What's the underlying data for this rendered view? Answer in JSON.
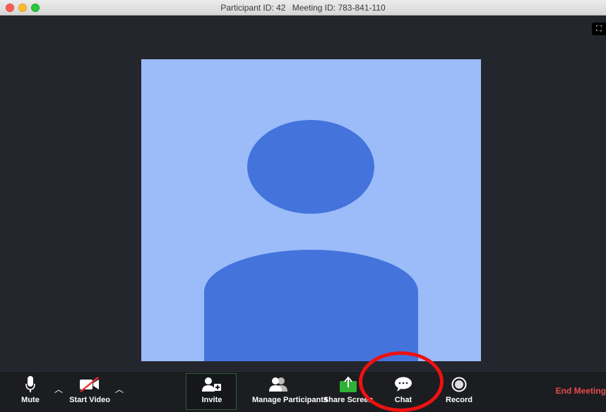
{
  "window": {
    "participant_id": "Participant ID: 42",
    "meeting_id": "Meeting ID: 783-841-110"
  },
  "toolbar": {
    "mute_label": "Mute",
    "start_video_label": "Start Video",
    "invite_label": "Invite",
    "manage_participants_label": "Manage Participants",
    "share_screen_label": "Share Screen",
    "chat_label": "Chat",
    "record_label": "Record",
    "end_meeting_label": "End Meeting"
  },
  "colors": {
    "video_background": "#9bbcf9",
    "avatar": "#4473dc",
    "end_meeting": "#e64c4c",
    "share_screen": "#2eb135",
    "annotation_circle": "#ee1111"
  },
  "icons": {
    "mute": "microphone-icon",
    "start_video": "video-off-icon",
    "invite": "add-user-icon",
    "manage_participants": "participants-icon",
    "share_screen": "share-screen-icon",
    "chat": "chat-bubble-icon",
    "record": "record-icon",
    "fullscreen": "fullscreen-icon"
  }
}
